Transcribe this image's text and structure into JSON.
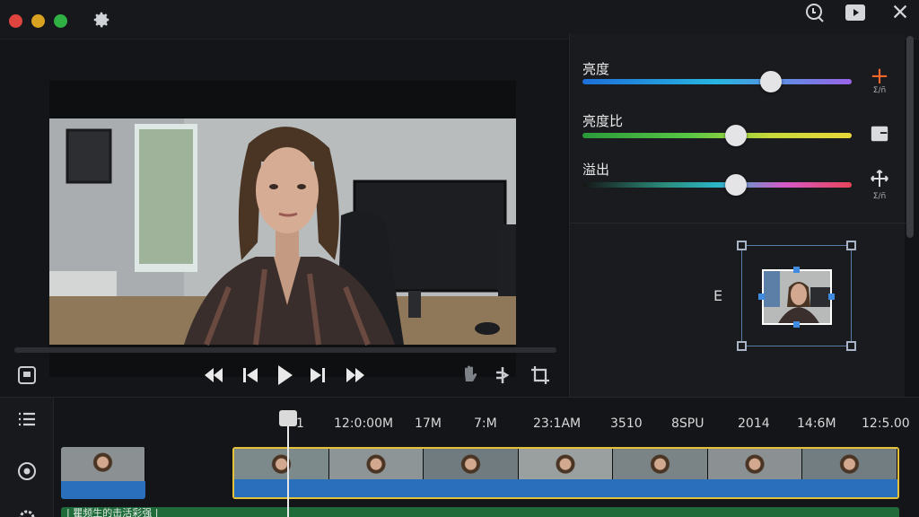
{
  "app": {
    "accent": "#f2662b",
    "selection_color": "#e6c23a"
  },
  "titlebar": {
    "controls": [
      "close-dot",
      "minimize-dot",
      "maximize-dot"
    ],
    "icons": [
      "settings-gear-icon",
      "magnifier-icon",
      "youtube-icon",
      "close-icon"
    ]
  },
  "preview": {
    "transport": [
      "rewind-icon",
      "previous-frame-icon",
      "play-icon",
      "next-frame-icon",
      "fast-forward-icon"
    ],
    "tools": [
      "save-icon",
      "hand-tool-icon",
      "split-icon",
      "crop-icon"
    ]
  },
  "adjustments": {
    "sliders": [
      {
        "label": "亮度",
        "value_fraction": 0.7
      },
      {
        "label": "亮度比",
        "value_fraction": 0.57
      },
      {
        "label": "溢出",
        "value_fraction": 0.57
      }
    ],
    "side_buttons": [
      {
        "icon": "add-icon",
        "caption": "Σ/ñ"
      },
      {
        "icon": "panel-icon",
        "caption": ""
      },
      {
        "icon": "move-icon",
        "caption": "Σ/ñ"
      }
    ]
  },
  "transform": {
    "label": "E"
  },
  "timeline": {
    "ruler": [
      "1",
      "12:0:00M",
      "17M",
      "7:M",
      "23:1AM",
      "3510",
      "8SPU",
      "2014",
      "14:6M",
      "12:5.00"
    ],
    "subtitle_track_text": "| 瞿频生的击活彩强 |",
    "side_icons": [
      "list-icon",
      "record-icon",
      "settings-small-icon"
    ]
  }
}
